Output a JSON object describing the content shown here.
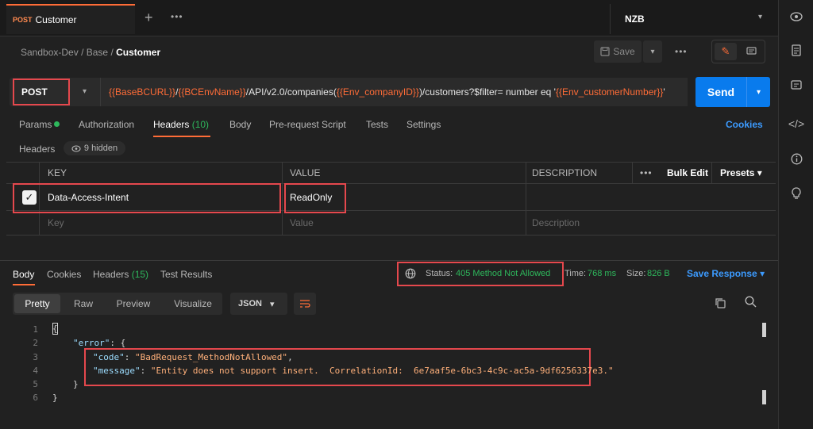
{
  "tab": {
    "method": "POST",
    "title": "Customer",
    "plus": "+",
    "more": "•••"
  },
  "environment": {
    "name": "NZB"
  },
  "breadcrumb": {
    "part1": "Sandbox-Dev",
    "sep": "/",
    "part2": "Base",
    "current": "Customer"
  },
  "toolbar": {
    "save_label": "Save",
    "more": "•••"
  },
  "request": {
    "method": "POST",
    "url_parts": [
      {
        "t": "{{BaseBCURL}}",
        "var": true
      },
      {
        "t": "/",
        "var": false
      },
      {
        "t": "{{BCEnvName}}",
        "var": true
      },
      {
        "t": "/API/v2.0/companies(",
        "var": false
      },
      {
        "t": "{{Env_companyID}}",
        "var": true
      },
      {
        "t": ")/customers?$filter= number eq '",
        "var": false
      },
      {
        "t": "{{Env_customerNumber}}",
        "var": true
      },
      {
        "t": "'",
        "var": false
      }
    ],
    "send_label": "Send"
  },
  "request_tabs": {
    "params": "Params",
    "authorization": "Authorization",
    "headers": "Headers",
    "headers_count": "(10)",
    "body": "Body",
    "prerequest": "Pre-request Script",
    "tests": "Tests",
    "settings": "Settings",
    "cookies": "Cookies"
  },
  "headers_section": {
    "title": "Headers",
    "hidden": "9 hidden"
  },
  "headers_table": {
    "columns": {
      "key": "KEY",
      "value": "VALUE",
      "description": "DESCRIPTION",
      "more": "•••",
      "bulk_edit": "Bulk Edit",
      "presets": "Presets"
    },
    "rows": [
      {
        "checked": true,
        "key": "Data-Access-Intent",
        "value": "ReadOnly"
      }
    ],
    "placeholder": {
      "key": "Key",
      "value": "Value",
      "description": "Description"
    }
  },
  "response_tabs": {
    "body": "Body",
    "cookies": "Cookies",
    "headers": "Headers",
    "headers_count": "(15)",
    "test_results": "Test Results"
  },
  "response_meta": {
    "status_label": "Status:",
    "status_value": "405 Method Not Allowed",
    "time_label": "Time:",
    "time_value": "768 ms",
    "size_label": "Size:",
    "size_value": "826 B",
    "save_response": "Save Response"
  },
  "format": {
    "pretty": "Pretty",
    "raw": "Raw",
    "preview": "Preview",
    "visualize": "Visualize",
    "language": "JSON"
  },
  "code": {
    "line_numbers": [
      "1",
      "2",
      "3",
      "4",
      "5",
      "6"
    ],
    "open_brace": "{",
    "error_key": "\"error\"",
    "error_open": ": {",
    "code_key": "\"code\"",
    "code_value": "\"BadRequest_MethodNotAllowed\"",
    "message_key": "\"message\"",
    "message_value": "\"Entity does not support insert.  CorrelationId:  6e7aaf5e-6bc3-4c9c-ac5a-9df6256337e3.\"",
    "inner_close": "}",
    "outer_close": "}"
  },
  "colors": {
    "accent": "#ff6c37",
    "send": "#097bed",
    "success": "#2eb85c",
    "link": "#3c9bff",
    "highlight": "#e5484d"
  }
}
